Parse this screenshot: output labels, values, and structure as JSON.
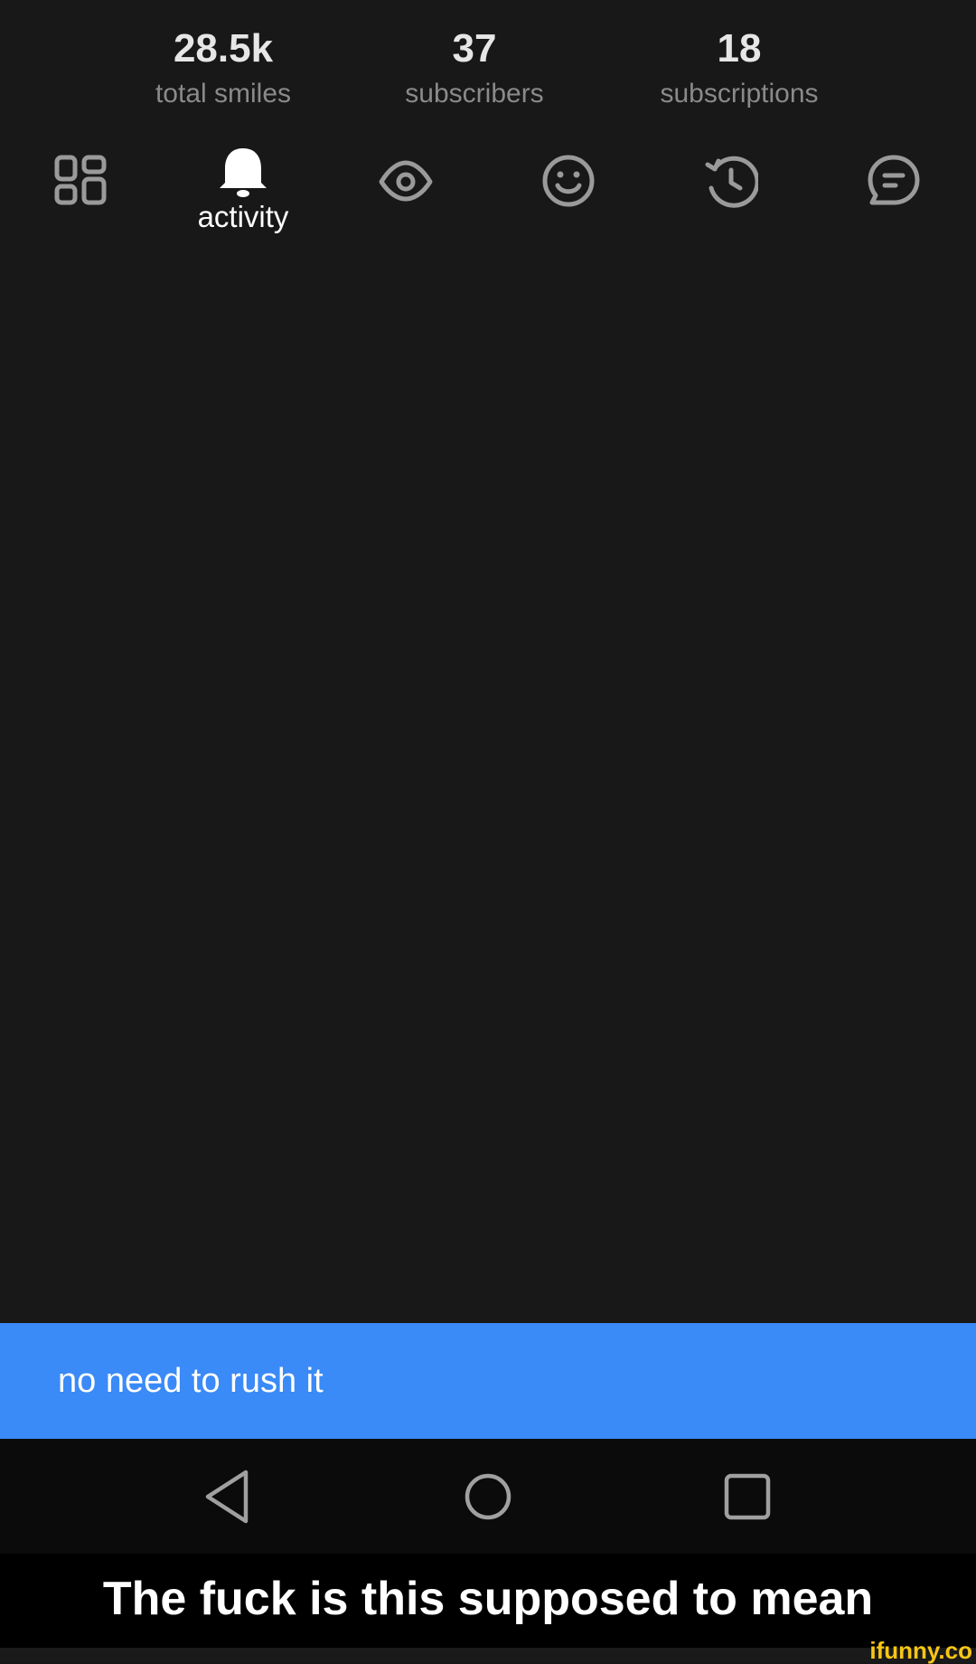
{
  "stats": [
    {
      "value": "28.5k",
      "label": "total smiles"
    },
    {
      "value": "37",
      "label": "subscribers"
    },
    {
      "value": "18",
      "label": "subscriptions"
    }
  ],
  "tabs": [
    {
      "icon": "grid-icon",
      "label": ""
    },
    {
      "icon": "bell-icon",
      "label": "activity"
    },
    {
      "icon": "eye-icon",
      "label": ""
    },
    {
      "icon": "smiley-icon",
      "label": ""
    },
    {
      "icon": "history-icon",
      "label": ""
    },
    {
      "icon": "chat-icon",
      "label": ""
    }
  ],
  "snackbar": {
    "text": "no need to rush it"
  },
  "navbar": {
    "icons": [
      "back-triangle-icon",
      "home-circle-icon",
      "recents-square-icon"
    ]
  },
  "caption": {
    "text": "The fuck is this supposed to mean"
  },
  "watermark": {
    "text": "ifunny.co"
  },
  "colors": {
    "background": "#181818",
    "snackbar": "#3a8af8",
    "icon_inactive": "#9a9a9a",
    "icon_active": "#ffffff",
    "watermark": "#f7c614"
  }
}
